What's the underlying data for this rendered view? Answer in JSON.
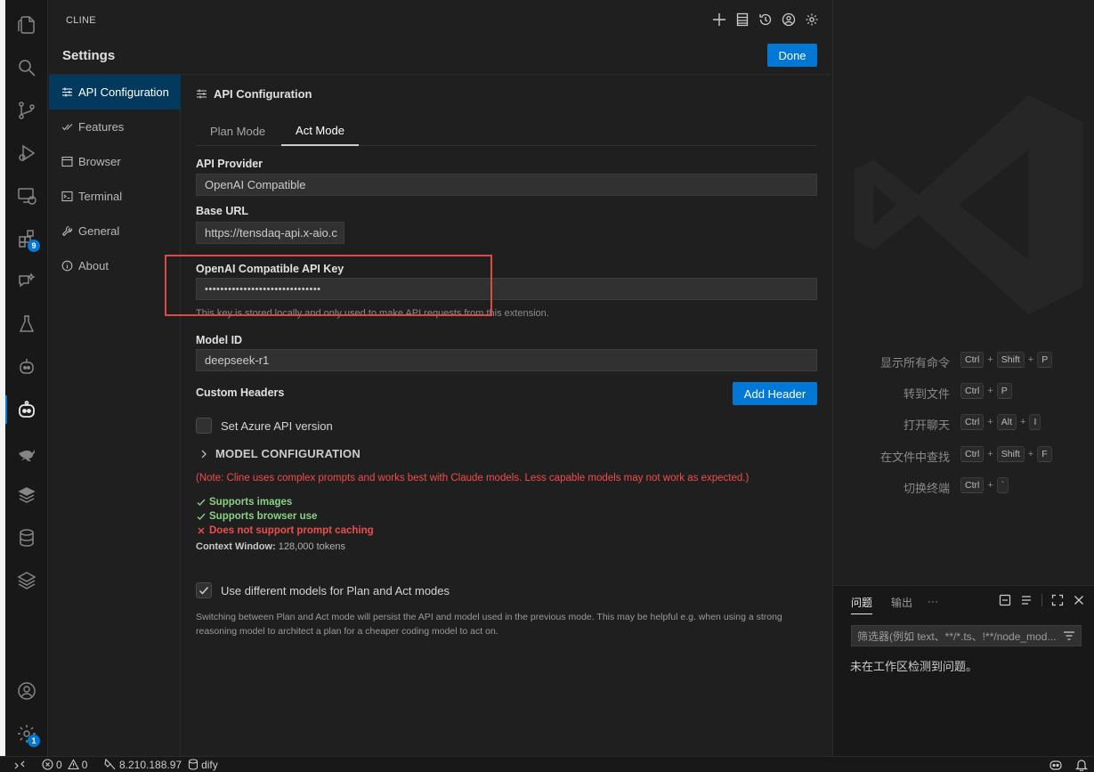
{
  "panel": {
    "title": "CLINE",
    "settings_title": "Settings",
    "done_label": "Done"
  },
  "activity_bar": {
    "extensions_badge": "9",
    "manage_badge": "1"
  },
  "nav": {
    "items": [
      {
        "label": "API Configuration",
        "icon": "sliders-icon"
      },
      {
        "label": "Features",
        "icon": "check-all-icon"
      },
      {
        "label": "Browser",
        "icon": "browser-icon"
      },
      {
        "label": "Terminal",
        "icon": "terminal-icon"
      },
      {
        "label": "General",
        "icon": "wrench-icon"
      },
      {
        "label": "About",
        "icon": "info-icon"
      }
    ]
  },
  "content": {
    "section_title": "API Configuration",
    "tabs": [
      "Plan Mode",
      "Act Mode"
    ],
    "active_tab": "Act Mode",
    "api_provider_label": "API Provider",
    "api_provider_value": "OpenAI Compatible",
    "base_url_label": "Base URL",
    "base_url_value": "https://tensdaq-api.x-aio.c",
    "api_key_label": "OpenAI Compatible API Key",
    "api_key_value": "••••••••••••••••••••••••••••••",
    "api_key_hint": "This key is stored locally and only used to make API requests from this extension.",
    "model_id_label": "Model ID",
    "model_id_value": "deepseek-r1",
    "custom_headers_label": "Custom Headers",
    "add_header_label": "Add Header",
    "azure_label": "Set Azure API version",
    "model_config_label": "MODEL CONFIGURATION",
    "note": "(Note: Cline uses complex prompts and works best with Claude models. Less capable models may not work as expected.)",
    "capabilities": [
      {
        "text": "Supports images",
        "ok": true
      },
      {
        "text": "Supports browser use",
        "ok": true
      },
      {
        "text": "Does not support prompt caching",
        "ok": false
      }
    ],
    "context_window_label": "Context Window:",
    "context_window_value": "128,000 tokens",
    "different_models_label": "Use different models for Plan and Act modes",
    "different_models_checked": true,
    "explanation": "Switching between Plan and Act mode will persist the API and model used in the previous mode. This may be helpful e.g. when using a strong reasoning model to architect a plan for a cheaper coding model to act on."
  },
  "editor": {
    "shortcuts": [
      {
        "label": "显示所有命令",
        "keys": [
          "Ctrl",
          "Shift",
          "P"
        ]
      },
      {
        "label": "转到文件",
        "keys": [
          "Ctrl",
          "P"
        ]
      },
      {
        "label": "打开聊天",
        "keys": [
          "Ctrl",
          "Alt",
          "I"
        ]
      },
      {
        "label": "在文件中查找",
        "keys": [
          "Ctrl",
          "Shift",
          "F"
        ]
      },
      {
        "label": "切换终端",
        "keys": [
          "Ctrl",
          "`"
        ]
      }
    ]
  },
  "problems": {
    "tabs": [
      "问题",
      "输出",
      "···"
    ],
    "filter_placeholder": "筛选器(例如 text、**/*.ts、!**/node_mod...",
    "message": "未在工作区检测到问题。"
  },
  "status_bar": {
    "errors": "0",
    "warnings": "0",
    "remote": "8.210.188.97",
    "db": "dify"
  },
  "colors": {
    "accent": "#0078d4",
    "error": "#f14c4c",
    "success": "#89d185",
    "highlight": "#e04848"
  }
}
